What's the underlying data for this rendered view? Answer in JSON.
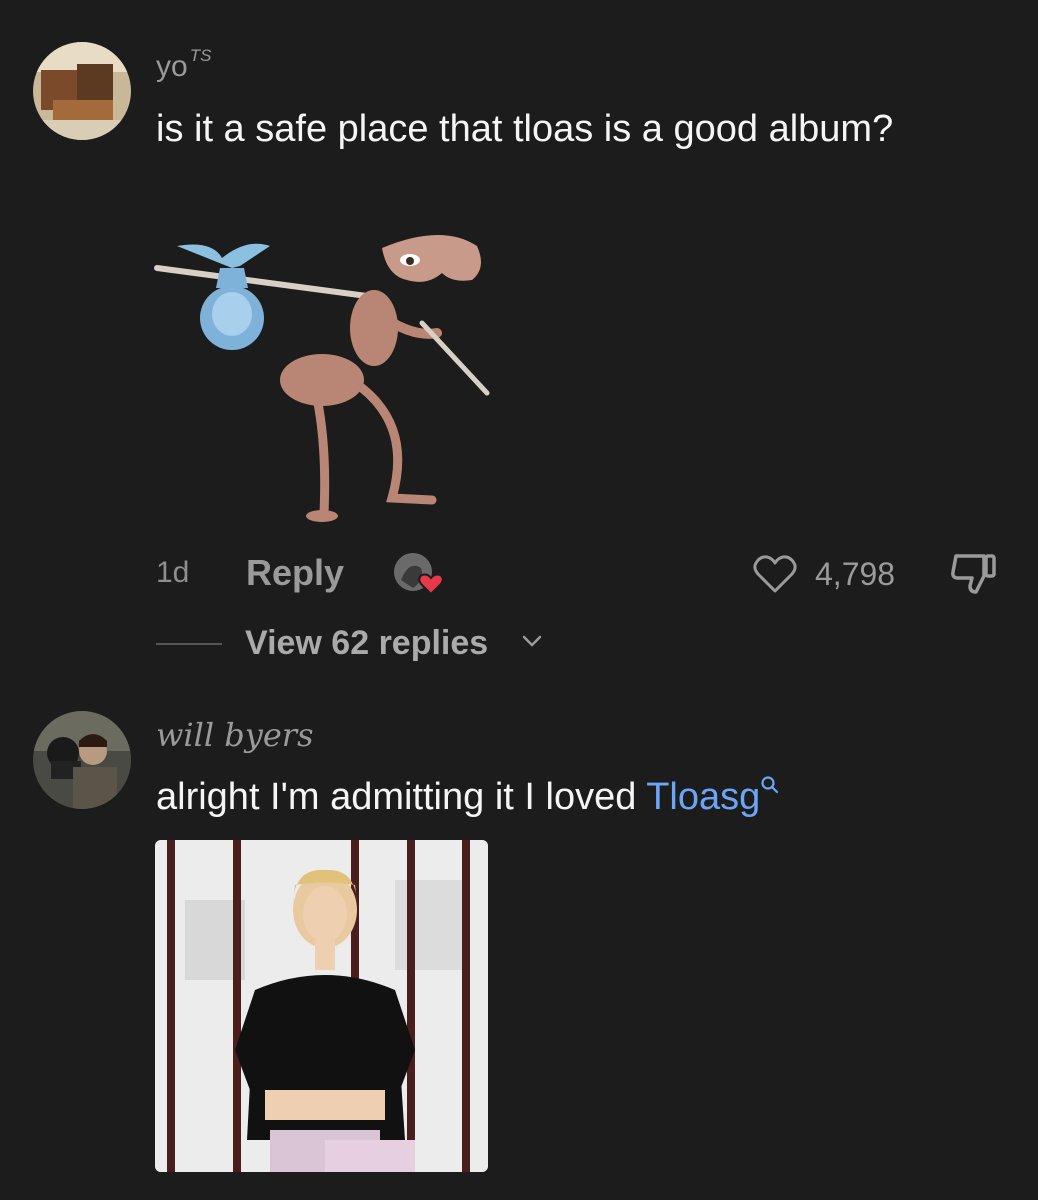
{
  "comments": [
    {
      "username": "yo",
      "username_suffix": "TS",
      "text": "is it a safe place that tloas is a good album?",
      "time": "1d",
      "reply_label": "Reply",
      "likes": "4,798",
      "view_replies": "View 62 replies"
    },
    {
      "username": "will byers",
      "text_plain": "alright I'm admitting it I loved ",
      "text_link": "Tloasg"
    }
  ],
  "colors": {
    "background": "#1c1c1c",
    "muted_text": "#9a9a9a",
    "link": "#6aa5f7",
    "heart_badge": "#e8394a"
  }
}
